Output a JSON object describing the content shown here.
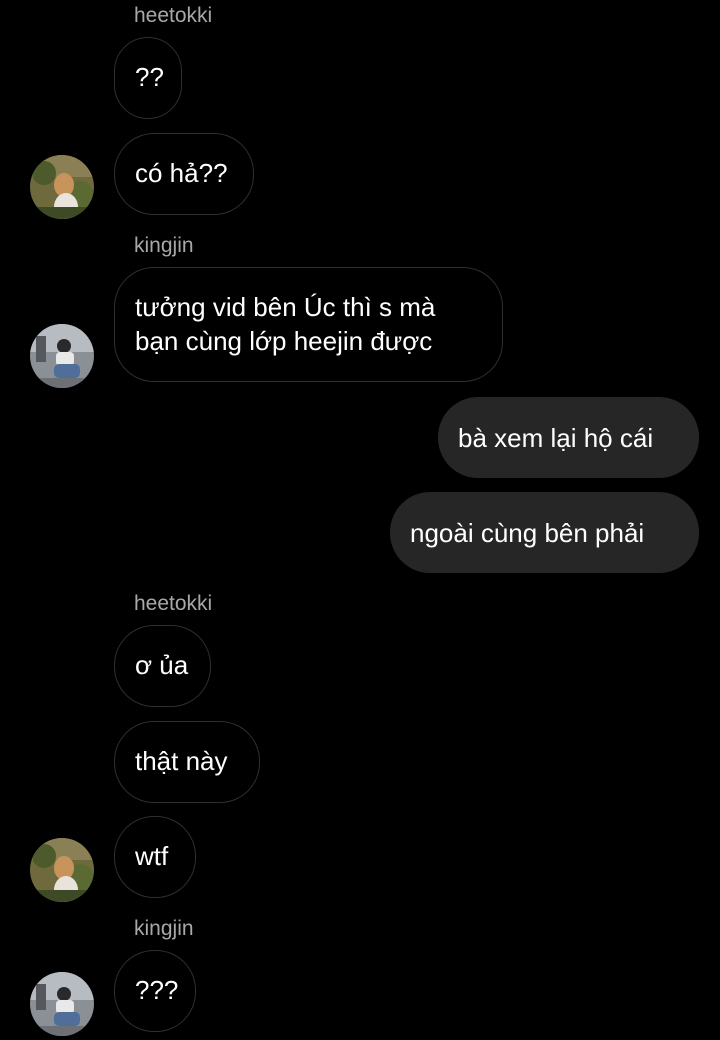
{
  "conversation": {
    "sender_labels": {
      "heetokki_1": "heetokki",
      "kingjin_1": "kingjin",
      "heetokki_2": "heetokki",
      "kingjin_2": "kingjin"
    },
    "messages": {
      "m1": "??",
      "m2": "có hả??",
      "m3_line1": "tưởng vid bên Úc thì s mà",
      "m3_line2": "bạn cùng lớp heejin được",
      "m4": "bà xem lại hộ cái",
      "m5": "ngoài cùng bên phải",
      "m6": "ơ ủa",
      "m7": "thật này",
      "m8": "wtf",
      "m9": "???"
    }
  },
  "colors": {
    "background": "#000000",
    "incoming_border": "#2f2f2f",
    "outgoing_bubble": "#262626",
    "sender_label": "#a8a8a8",
    "text": "#ffffff"
  },
  "icons": {
    "avatar_heetokki": "avatar-heetokki",
    "avatar_kingjin": "avatar-kingjin"
  }
}
